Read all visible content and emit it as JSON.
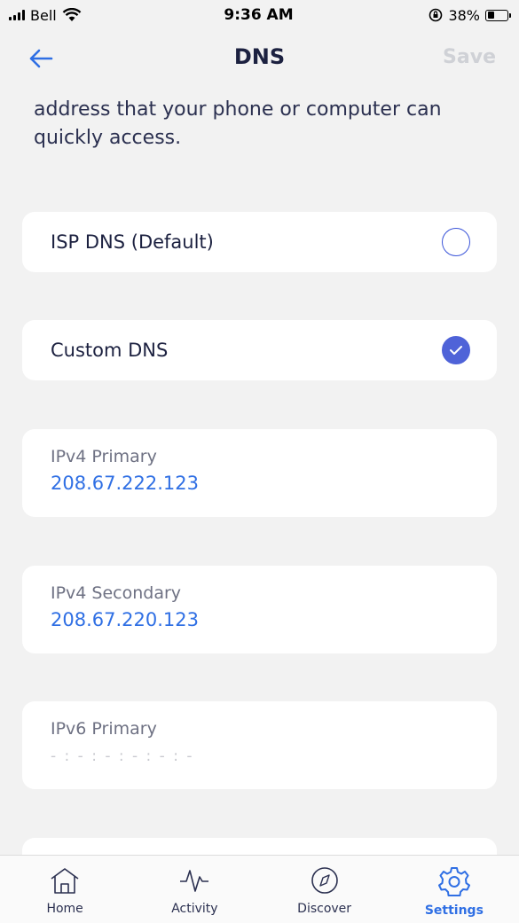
{
  "status_bar": {
    "carrier": "Bell",
    "time": "9:36 AM",
    "battery": "38%"
  },
  "nav": {
    "title": "DNS",
    "save_label": "Save"
  },
  "description": "address that your phone or computer can quickly access.",
  "options": [
    {
      "label": "ISP DNS (Default)",
      "selected": false
    },
    {
      "label": "Custom DNS",
      "selected": true
    }
  ],
  "fields": [
    {
      "label": "IPv4 Primary",
      "value": "208.67.222.123"
    },
    {
      "label": "IPv4 Secondary",
      "value": "208.67.220.123"
    },
    {
      "label": "IPv6 Primary",
      "placeholder": "- : - : - : - : - : -"
    }
  ],
  "tabs": [
    {
      "label": "Home",
      "icon": "home-icon",
      "active": false
    },
    {
      "label": "Activity",
      "icon": "activity-icon",
      "active": false
    },
    {
      "label": "Discover",
      "icon": "compass-icon",
      "active": false
    },
    {
      "label": "Settings",
      "icon": "gear-icon",
      "active": true
    }
  ],
  "colors": {
    "accent": "#2f6fe4",
    "radio_checked": "#4f63d8",
    "background": "#f2f2f2"
  }
}
